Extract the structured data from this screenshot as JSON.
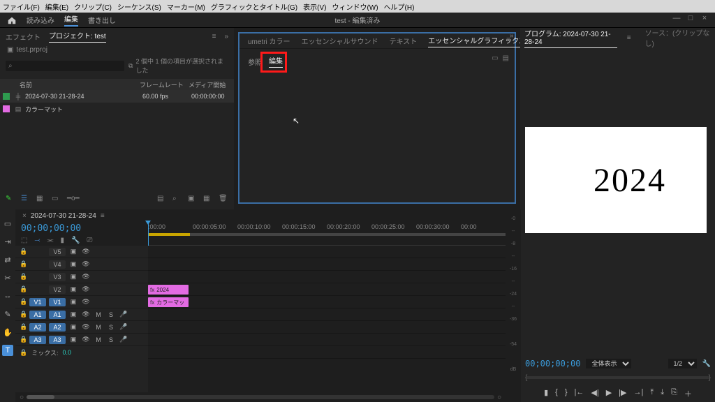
{
  "menu": {
    "file": "ファイル(F)",
    "edit": "編集(E)",
    "clip": "クリップ(C)",
    "sequence": "シーケンス(S)",
    "marker": "マーカー(M)",
    "graphics": "グラフィックとタイトル(G)",
    "view": "表示(V)",
    "window": "ウィンドウ(W)",
    "help": "ヘルプ(H)"
  },
  "workspace": {
    "import": "読み込み",
    "edit": "編集",
    "export": "書き出し"
  },
  "document_title": "test - 編集済み",
  "project": {
    "tab_effects": "エフェクト",
    "tab_project": "プロジェクト: test",
    "filename": "test.prproj",
    "search_placeholder": "",
    "filter_text": "2 個中 1 個の項目が選択されました",
    "col_name": "名前",
    "col_framerate": "フレームレート",
    "col_mediastart": "メディア開始",
    "items": [
      {
        "name": "2024-07-30 21-28-24",
        "framerate": "60.00 fps",
        "mediastart": "00:00:00:00",
        "color": "green",
        "icon": "seq"
      },
      {
        "name": "カラーマット",
        "framerate": "",
        "mediastart": "",
        "color": "pink",
        "icon": "file"
      }
    ]
  },
  "eg": {
    "tab_lumetri": "umetri カラー",
    "tab_sound": "エッセンシャルサウンド",
    "tab_text": "テキスト",
    "tab_graphics": "エッセンシャルグラフィックス",
    "sub_browse": "参照",
    "sub_edit": "編集"
  },
  "program": {
    "tab_label": "プログラム: 2024-07-30 21-28-24",
    "tab_source": "ソース：(クリップなし)",
    "preview_text": "2024"
  },
  "timeline": {
    "seq_name": "2024-07-30 21-28-24",
    "playhead": "00;00;00;00",
    "ruler": [
      ":00:00",
      "00:00:05:00",
      "00:00:10:00",
      "00:00:15:00",
      "00:00:20:00",
      "00:00:25:00",
      "00:00:30:00",
      "00:00"
    ],
    "video_tracks": [
      "V5",
      "V4",
      "V3",
      "V2",
      "V1"
    ],
    "audio_tracks": [
      "A1",
      "A2",
      "A3"
    ],
    "mix_label": "ミックス:",
    "mix_value": "0.0",
    "clip_v2": "2024",
    "clip_v1": "カラーマッ"
  },
  "meter_marks": [
    "-0",
    "--",
    "-8",
    "--",
    "-16",
    "--",
    "-24",
    "--",
    "-36",
    "",
    "-54",
    "",
    "dB"
  ],
  "program_ctrl": {
    "timecode": "00;00;00;00",
    "fit": "全体表示",
    "scale": "1/2"
  }
}
